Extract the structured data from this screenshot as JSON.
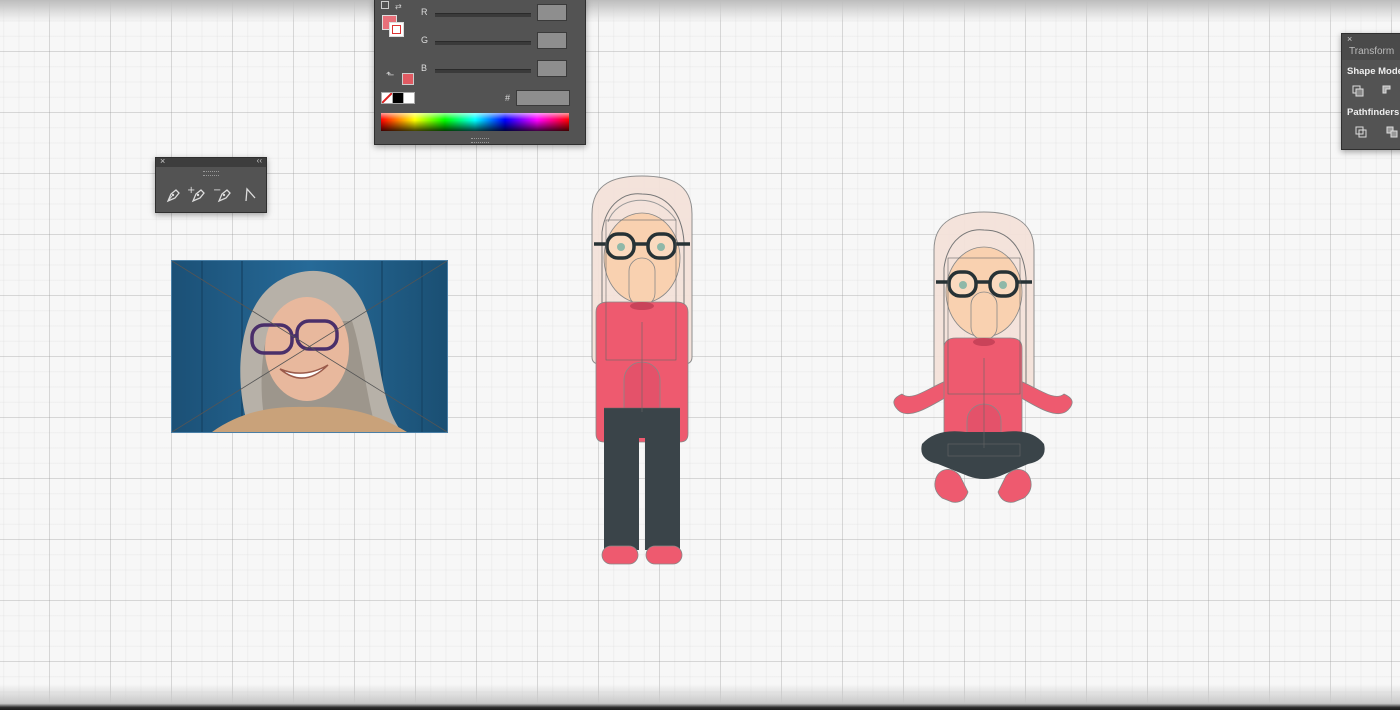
{
  "app": {
    "name": "vector illustration editor"
  },
  "color_panel": {
    "channels": [
      {
        "label": "R"
      },
      {
        "label": "G"
      },
      {
        "label": "B"
      }
    ],
    "hex_label": "#",
    "fill_color": "#e8707a",
    "stroke": "none-red-slash"
  },
  "pen_panel": {
    "close_glyph": "×",
    "collapse_glyph": "‹‹",
    "tools": [
      "pen-icon",
      "add-anchor-icon",
      "delete-anchor-icon",
      "convert-anchor-icon"
    ]
  },
  "pathfinder_panel": {
    "close_glyph": "×",
    "tab_label": "Transform",
    "shape_modes_label": "Shape Modes",
    "pathfinders_label": "Pathfinders:"
  },
  "artboard": {
    "reference_photo": "portrait-photo",
    "illustrations": [
      "standing-character",
      "sitting-character"
    ]
  },
  "colors": {
    "shirt": "#ee5a6f",
    "pants": "#3a4449",
    "skin": "#f9d1b0",
    "hair": "#f4e2da",
    "panel_bg": "#535353"
  }
}
